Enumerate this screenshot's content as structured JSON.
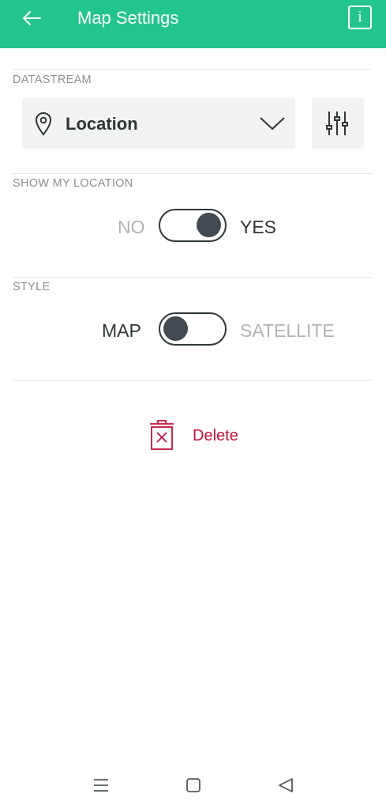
{
  "header": {
    "title": "Map Settings",
    "back_icon": "arrow-left-icon",
    "info_label": "i"
  },
  "datastream": {
    "label": "DATASTREAM",
    "selected": "Location",
    "icons": [
      "map-pin-icon",
      "chevron-down-icon",
      "sliders-icon"
    ]
  },
  "show_my_location": {
    "label": "SHOW MY LOCATION",
    "off_label": "NO",
    "on_label": "YES",
    "value": "YES"
  },
  "style": {
    "label": "STYLE",
    "left_label": "MAP",
    "right_label": "SATELLITE",
    "value": "MAP"
  },
  "actions": {
    "delete_label": "Delete",
    "delete_icon": "trash-icon"
  },
  "system_nav": {
    "icons": [
      "menu-icon",
      "home-icon",
      "back-triangle-icon"
    ]
  },
  "colors": {
    "header": "#23c48e",
    "delete": "#c1133e",
    "toggle": "#434a4f"
  }
}
